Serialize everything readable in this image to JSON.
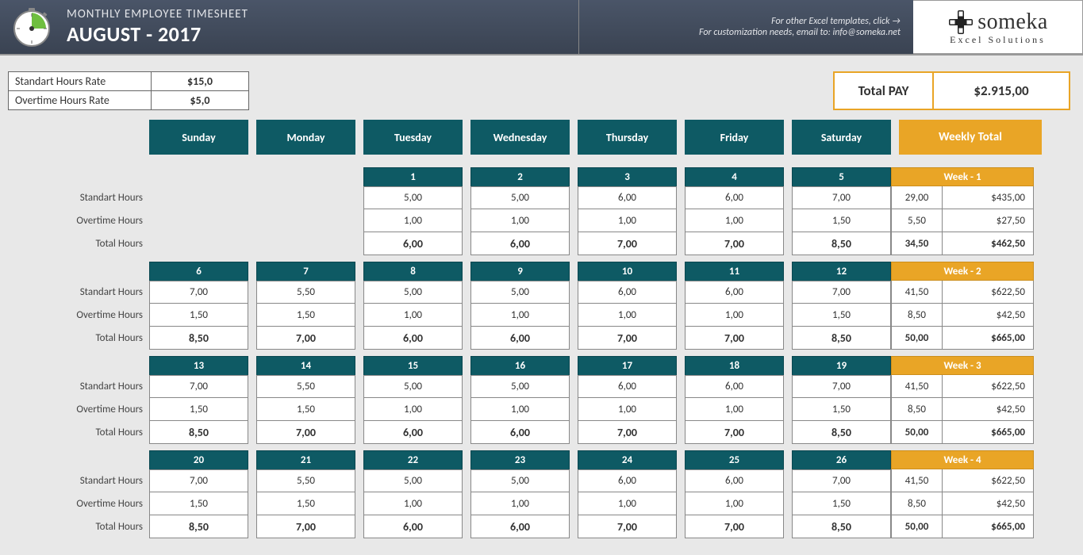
{
  "header": {
    "subtitle": "MONTHLY EMPLOYEE TIMESHEET",
    "title": "AUGUST - 2017",
    "link_text": "For other Excel templates, click →",
    "email_text": "For customization needs, email to: info@someka.net",
    "logo_text": "someka",
    "logo_sub": "Excel Solutions"
  },
  "rates": {
    "std_label": "Standart Hours Rate",
    "std_value": "$15,0",
    "ot_label": "Overtime Hours Rate",
    "ot_value": "$5,0"
  },
  "total_pay": {
    "label": "Total PAY",
    "value": "$2.915,00"
  },
  "days": [
    "Sunday",
    "Monday",
    "Tuesday",
    "Wednesday",
    "Thursday",
    "Friday",
    "Saturday"
  ],
  "weekly_total_header": "Weekly Total",
  "row_labels": {
    "std": "Standart Hours",
    "ot": "Overtime Hours",
    "total": "Total Hours"
  },
  "weeks": [
    {
      "name": "Week - 1",
      "cells": [
        {
          "blank": true
        },
        {
          "blank": true
        },
        {
          "num": "1",
          "std": "5,00",
          "ot": "1,00",
          "tot": "6,00"
        },
        {
          "num": "2",
          "std": "5,00",
          "ot": "1,00",
          "tot": "6,00"
        },
        {
          "num": "3",
          "std": "6,00",
          "ot": "1,00",
          "tot": "7,00"
        },
        {
          "num": "4",
          "std": "6,00",
          "ot": "1,00",
          "tot": "7,00"
        },
        {
          "num": "5",
          "std": "7,00",
          "ot": "1,50",
          "tot": "8,50"
        }
      ],
      "totals": {
        "std_h": "29,00",
        "std_p": "$435,00",
        "ot_h": "5,50",
        "ot_p": "$27,50",
        "tot_h": "34,50",
        "tot_p": "$462,50"
      }
    },
    {
      "name": "Week - 2",
      "cells": [
        {
          "num": "6",
          "std": "7,00",
          "ot": "1,50",
          "tot": "8,50"
        },
        {
          "num": "7",
          "std": "5,50",
          "ot": "1,50",
          "tot": "7,00"
        },
        {
          "num": "8",
          "std": "5,00",
          "ot": "1,00",
          "tot": "6,00"
        },
        {
          "num": "9",
          "std": "5,00",
          "ot": "1,00",
          "tot": "6,00"
        },
        {
          "num": "10",
          "std": "6,00",
          "ot": "1,00",
          "tot": "7,00"
        },
        {
          "num": "11",
          "std": "6,00",
          "ot": "1,00",
          "tot": "7,00"
        },
        {
          "num": "12",
          "std": "7,00",
          "ot": "1,50",
          "tot": "8,50"
        }
      ],
      "totals": {
        "std_h": "41,50",
        "std_p": "$622,50",
        "ot_h": "8,50",
        "ot_p": "$42,50",
        "tot_h": "50,00",
        "tot_p": "$665,00"
      }
    },
    {
      "name": "Week - 3",
      "cells": [
        {
          "num": "13",
          "std": "7,00",
          "ot": "1,50",
          "tot": "8,50"
        },
        {
          "num": "14",
          "std": "5,50",
          "ot": "1,50",
          "tot": "7,00"
        },
        {
          "num": "15",
          "std": "5,00",
          "ot": "1,00",
          "tot": "6,00"
        },
        {
          "num": "16",
          "std": "5,00",
          "ot": "1,00",
          "tot": "6,00"
        },
        {
          "num": "17",
          "std": "6,00",
          "ot": "1,00",
          "tot": "7,00"
        },
        {
          "num": "18",
          "std": "6,00",
          "ot": "1,00",
          "tot": "7,00"
        },
        {
          "num": "19",
          "std": "7,00",
          "ot": "1,50",
          "tot": "8,50"
        }
      ],
      "totals": {
        "std_h": "41,50",
        "std_p": "$622,50",
        "ot_h": "8,50",
        "ot_p": "$42,50",
        "tot_h": "50,00",
        "tot_p": "$665,00"
      }
    },
    {
      "name": "Week - 4",
      "cells": [
        {
          "num": "20",
          "std": "7,00",
          "ot": "1,50",
          "tot": "8,50"
        },
        {
          "num": "21",
          "std": "5,50",
          "ot": "1,50",
          "tot": "7,00"
        },
        {
          "num": "22",
          "std": "5,00",
          "ot": "1,00",
          "tot": "6,00"
        },
        {
          "num": "23",
          "std": "5,00",
          "ot": "1,00",
          "tot": "6,00"
        },
        {
          "num": "24",
          "std": "6,00",
          "ot": "1,00",
          "tot": "7,00"
        },
        {
          "num": "25",
          "std": "6,00",
          "ot": "1,00",
          "tot": "7,00"
        },
        {
          "num": "26",
          "std": "7,00",
          "ot": "1,50",
          "tot": "8,50"
        }
      ],
      "totals": {
        "std_h": "41,50",
        "std_p": "$622,50",
        "ot_h": "8,50",
        "ot_p": "$42,50",
        "tot_h": "50,00",
        "tot_p": "$665,00"
      }
    }
  ]
}
